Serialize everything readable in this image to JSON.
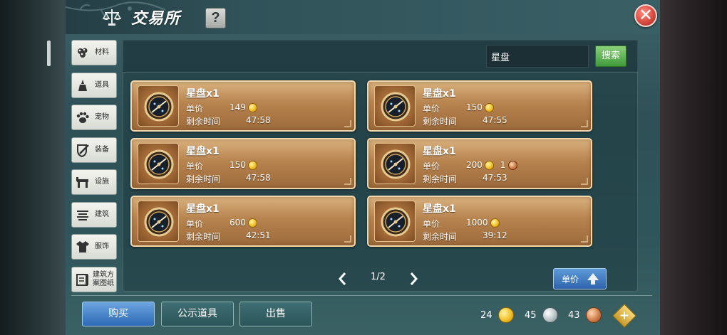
{
  "window": {
    "title": "交易所",
    "help_label": "?",
    "close_label": "✕"
  },
  "sidebar": {
    "items": [
      {
        "label": "材料",
        "icon": "materials-icon"
      },
      {
        "label": "道具",
        "icon": "props-icon"
      },
      {
        "label": "宠物",
        "icon": "pet-paw-icon"
      },
      {
        "label": "装备",
        "icon": "equipment-icon"
      },
      {
        "label": "设施",
        "icon": "facility-icon"
      },
      {
        "label": "建筑",
        "icon": "building-icon"
      },
      {
        "label": "服饰",
        "icon": "clothing-icon"
      },
      {
        "label_line1": "建筑方",
        "label_line2": "案图纸",
        "icon": "blueprint-icon"
      }
    ]
  },
  "search": {
    "value": "星盘",
    "button_label": "搜索"
  },
  "listings": [
    {
      "name": "星盘x1",
      "price_label": "单价",
      "gold": "149",
      "copper": "",
      "time_label": "剩余时间",
      "time": "47:58"
    },
    {
      "name": "星盘x1",
      "price_label": "单价",
      "gold": "150",
      "copper": "",
      "time_label": "剩余时间",
      "time": "47:55"
    },
    {
      "name": "星盘x1",
      "price_label": "单价",
      "gold": "150",
      "copper": "",
      "time_label": "剩余时间",
      "time": "47:58"
    },
    {
      "name": "星盘x1",
      "price_label": "单价",
      "gold": "200",
      "copper": "1",
      "time_label": "剩余时间",
      "time": "47:53"
    },
    {
      "name": "星盘x1",
      "price_label": "单价",
      "gold": "600",
      "copper": "",
      "time_label": "剩余时间",
      "time": "42:51"
    },
    {
      "name": "星盘x1",
      "price_label": "单价",
      "gold": "1000",
      "copper": "",
      "time_label": "剩余时间",
      "time": "39:12"
    }
  ],
  "pagination": {
    "text": "1/2"
  },
  "sort": {
    "label": "单价"
  },
  "bottom_tabs": {
    "buy": "购买",
    "public": "公示道具",
    "sell": "出售"
  },
  "currency": {
    "gold": "24",
    "silver": "45",
    "copper": "43"
  },
  "colors": {
    "accent_blue": "#2e6ab5",
    "search_green": "#3f9a3b",
    "card_brown": "#b7834e",
    "close_red": "#d94a3e"
  }
}
